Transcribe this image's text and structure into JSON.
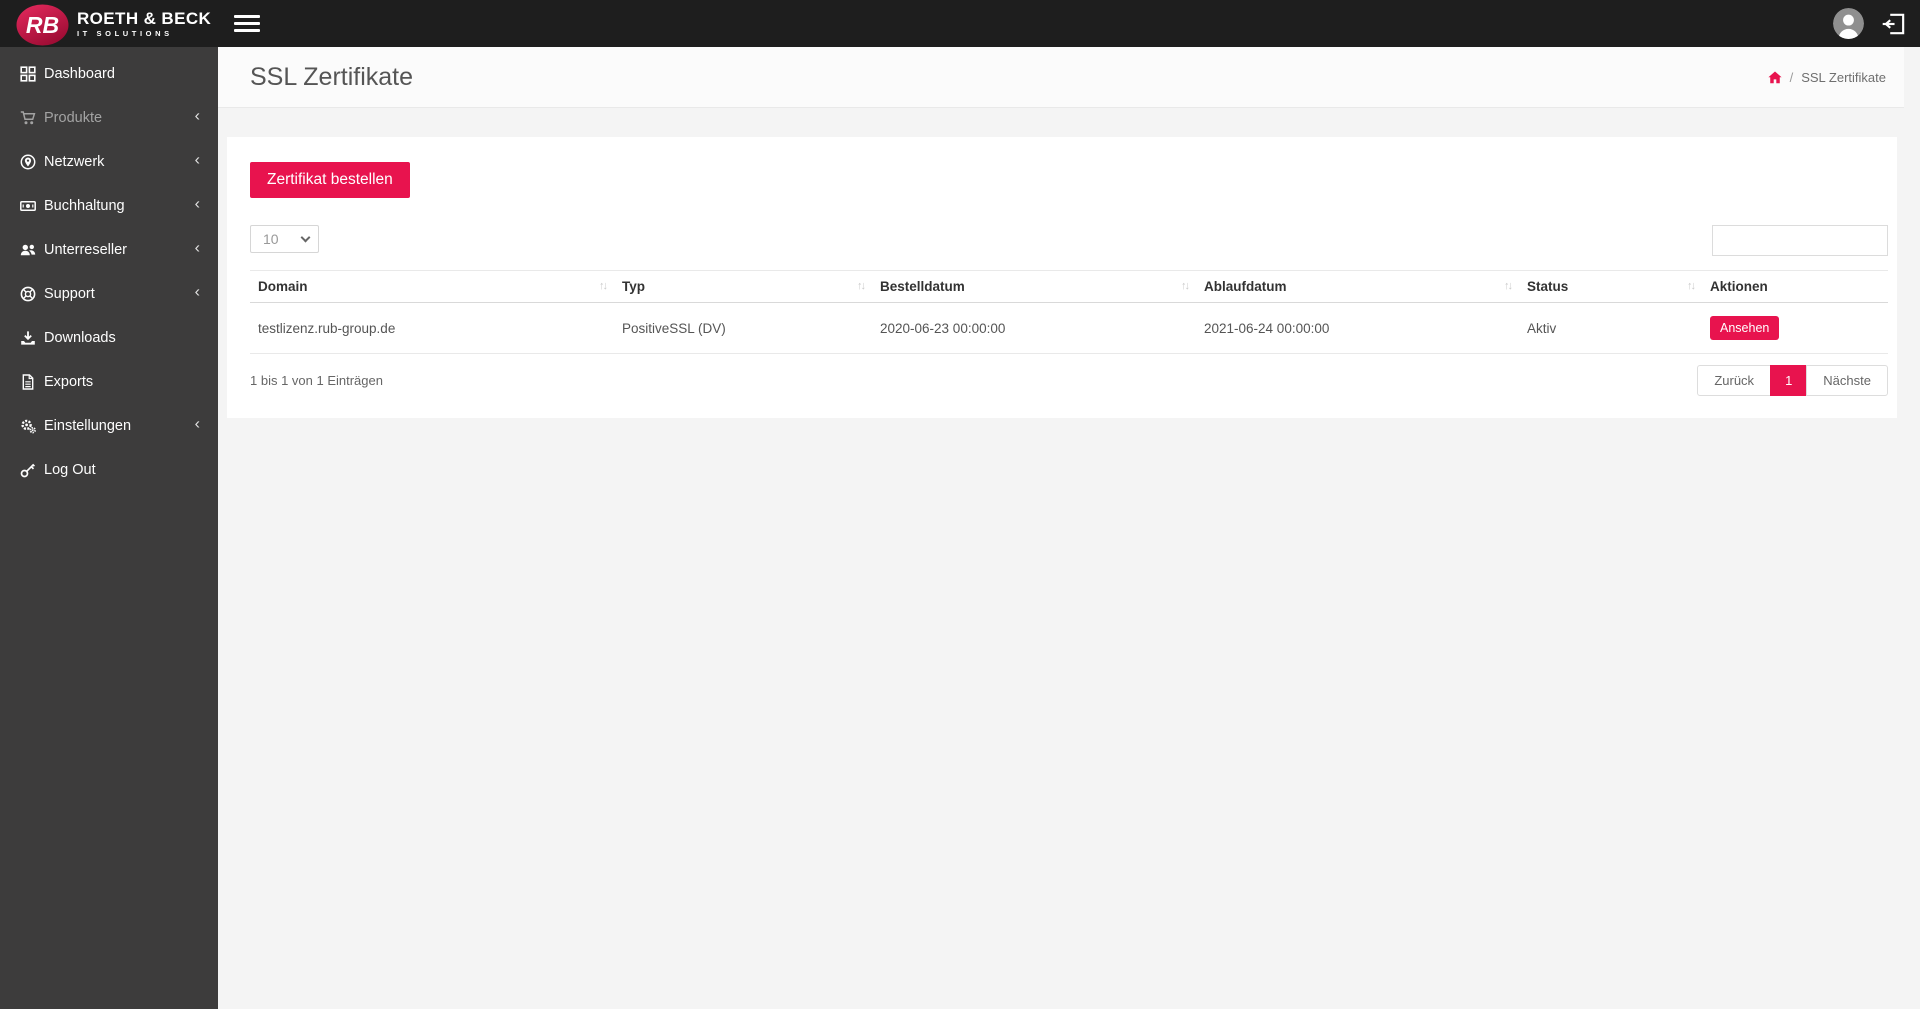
{
  "topbar": {
    "logo_monogram": "RB",
    "logo_title": "ROETH & BECK",
    "logo_subtitle": "IT SOLUTIONS"
  },
  "sidebar": {
    "chevron": "‹",
    "items": [
      {
        "label": "Dashboard",
        "icon": "dashboard-grid-icon",
        "expandable": false,
        "dimmed": false
      },
      {
        "label": "Produkte",
        "icon": "cart-icon",
        "expandable": true,
        "dimmed": true
      },
      {
        "label": "Netzwerk",
        "icon": "network-pin-icon",
        "expandable": true,
        "dimmed": false
      },
      {
        "label": "Buchhaltung",
        "icon": "money-bill-icon",
        "expandable": true,
        "dimmed": false
      },
      {
        "label": "Unterreseller",
        "icon": "users-icon",
        "expandable": true,
        "dimmed": false
      },
      {
        "label": "Support",
        "icon": "life-ring-icon",
        "expandable": true,
        "dimmed": false
      },
      {
        "label": "Downloads",
        "icon": "download-icon",
        "expandable": false,
        "dimmed": false
      },
      {
        "label": "Exports",
        "icon": "file-icon",
        "expandable": false,
        "dimmed": false
      },
      {
        "label": "Einstellungen",
        "icon": "gears-icon",
        "expandable": true,
        "dimmed": false
      },
      {
        "label": "Log Out",
        "icon": "key-icon",
        "expandable": false,
        "dimmed": false
      }
    ]
  },
  "header": {
    "title": "SSL Zertifikate",
    "breadcrumb": {
      "home_icon": "home-icon",
      "separator": "/",
      "current": "SSL Zertifikate"
    }
  },
  "content": {
    "order_button": "Zertifikat bestellen",
    "page_length_selected": "10",
    "search_value": "",
    "table": {
      "columns": [
        {
          "label": "Domain",
          "key": "domain",
          "sortable": true,
          "type": "text"
        },
        {
          "label": "Typ",
          "key": "typ",
          "sortable": true,
          "type": "text"
        },
        {
          "label": "Bestelldatum",
          "key": "bestelldatum",
          "sortable": true,
          "type": "text"
        },
        {
          "label": "Ablaufdatum",
          "key": "ablaufdatum",
          "sortable": true,
          "type": "text"
        },
        {
          "label": "Status",
          "key": "status",
          "sortable": true,
          "type": "text"
        },
        {
          "label": "Aktionen",
          "key": "action",
          "sortable": false,
          "type": "button"
        }
      ],
      "sort_glyph": "↑↓",
      "rows": [
        {
          "domain": "testlizenz.rub-group.de",
          "typ": "PositiveSSL (DV)",
          "bestelldatum": "2020-06-23 00:00:00",
          "ablaufdatum": "2021-06-24 00:00:00",
          "status": "Aktiv",
          "action": "Ansehen"
        }
      ],
      "info": "1 bis 1 von 1 Einträgen",
      "pagination": {
        "prev": "Zurück",
        "page": "1",
        "next": "Nächste"
      }
    }
  },
  "colors": {
    "accent": "#e8134e",
    "topbar_bg": "#1e1e1e",
    "sidebar_bg": "#3d3c3c",
    "body_bg": "#f4f4f4",
    "card_bg": "#ffffff"
  }
}
